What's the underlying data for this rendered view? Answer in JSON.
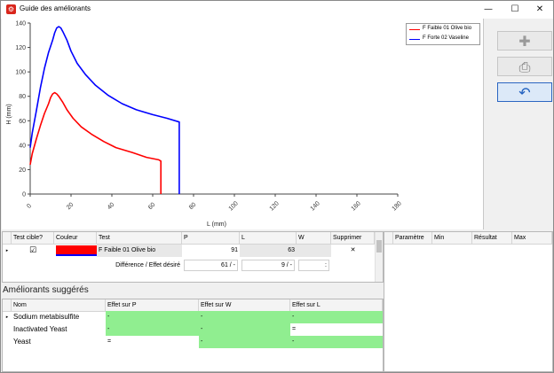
{
  "window": {
    "title": "Guide des améliorants",
    "minimize": "—",
    "maximize": "☐",
    "close": "✕",
    "app_icon": "⚙"
  },
  "chart_data": {
    "type": "line",
    "xlabel": "L (mm)",
    "ylabel": "H (mm)",
    "xlim": [
      0,
      180
    ],
    "ylim": [
      0,
      140
    ],
    "xticks": [
      "0",
      "20",
      "40",
      "60",
      "80",
      "100",
      "120",
      "140",
      "160",
      "180"
    ],
    "yticks": [
      "0",
      "20",
      "40",
      "60",
      "80",
      "100",
      "120",
      "140"
    ],
    "grid": false,
    "legend_position": "top-right",
    "series": [
      {
        "name": "F Faible 01 Olive bio",
        "color": "#ff0000",
        "x": [
          0,
          1,
          3,
          5,
          7,
          9,
          10,
          11,
          12,
          13,
          14,
          16,
          18,
          21,
          25,
          30,
          36,
          42,
          50,
          57,
          63,
          64,
          64
        ],
        "y": [
          24,
          33,
          45,
          56,
          66,
          74,
          79,
          82,
          83,
          82,
          80,
          75,
          69,
          62,
          55,
          49,
          43,
          38,
          34,
          30,
          28,
          27,
          0
        ]
      },
      {
        "name": "F Forte 02 Vaseline",
        "color": "#0000ff",
        "x": [
          0,
          1,
          3,
          5,
          7,
          9,
          11,
          12,
          13,
          14,
          15,
          16,
          18,
          20,
          23,
          27,
          32,
          38,
          45,
          52,
          60,
          67,
          73,
          73
        ],
        "y": [
          38,
          50,
          68,
          87,
          103,
          116,
          126,
          132,
          136,
          137,
          136,
          133,
          126,
          117,
          107,
          98,
          89,
          81,
          74,
          69,
          65,
          62,
          59,
          0
        ]
      }
    ]
  },
  "actions": {
    "add_icon": "✚",
    "print_icon": "⎙",
    "back_icon": "↶"
  },
  "tests_grid": {
    "headers": {
      "target": "Test cible?",
      "color": "Couleur",
      "test": "Test",
      "p": "P",
      "l": "L",
      "w": "W",
      "delete": "Supprimer"
    },
    "rows": [
      {
        "indicator": "▸",
        "target": "☑",
        "color": "#ff0000",
        "underline": "#0000ff",
        "test": "F Faible 01 Olive bio",
        "p": "91",
        "l": "63",
        "w": "",
        "delete": "✕"
      }
    ],
    "diff_row": {
      "label": "Différence / Effet désiré",
      "p": "61 / -",
      "l": "9 / -",
      "w": ":"
    }
  },
  "params_grid": {
    "headers": [
      "Paramètre",
      "Min",
      "Résultat",
      "Max"
    ]
  },
  "suggestions": {
    "title": "Améliorants suggérés",
    "headers": {
      "name": "Nom",
      "p": "Effet sur P",
      "w": "Effet sur W",
      "l": "Effet sur L"
    },
    "rows": [
      {
        "indicator": "▸",
        "name": "Sodium metabisulfite",
        "p": "-",
        "w": "-",
        "l": "-"
      },
      {
        "indicator": "",
        "name": "Inactivated Yeast",
        "p": "-",
        "w": "-",
        "l": "="
      },
      {
        "indicator": "",
        "name": "Yeast",
        "p": "=",
        "w": "-",
        "l": "-"
      }
    ]
  }
}
